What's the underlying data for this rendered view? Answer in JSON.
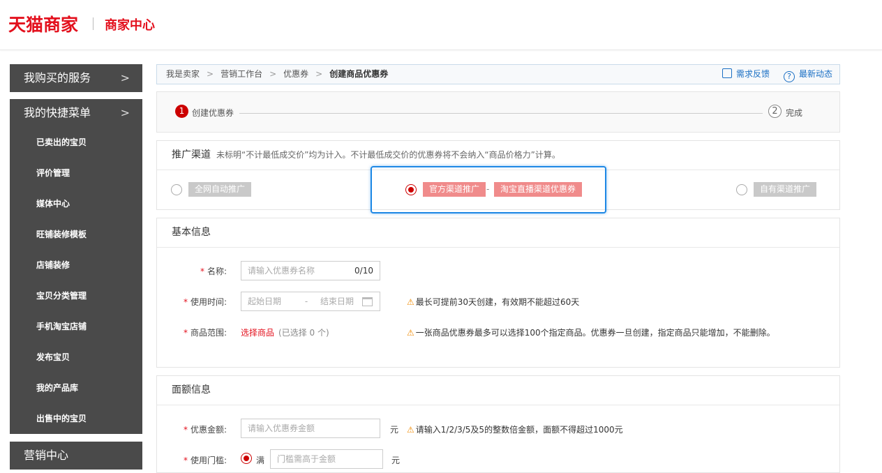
{
  "header": {
    "logo": "天猫商家",
    "sub": "商家中心"
  },
  "sidebar": {
    "section1": "我购买的服务",
    "section2": "我的快捷菜单",
    "items": [
      "已卖出的宝贝",
      "评价管理",
      "媒体中心",
      "旺铺装修模板",
      "店铺装修",
      "宝贝分类管理",
      "手机淘宝店铺",
      "发布宝贝",
      "我的产品库",
      "出售中的宝贝"
    ],
    "section3": "营销中心",
    "chevron": ">"
  },
  "breadcrumb": {
    "items": [
      "我是卖家",
      "营销工作台",
      "优惠券",
      "创建商品优惠券"
    ],
    "separator": ">",
    "feedback": "需求反馈",
    "news": "最新动态",
    "help_icon_glyph": "?"
  },
  "steps": {
    "step1_num": "1",
    "step1": "创建优惠券",
    "step2_num": "2",
    "step2": "完成"
  },
  "channel": {
    "title": "推广渠道",
    "note": "未标明“不计最低成交价”均为计入。不计最低成交价的优惠券将不会纳入“商品价格力”计算。",
    "option1": "全网自动推广",
    "option2a": "官方渠道推广",
    "option2_sep": "-",
    "option2b": "淘宝直播渠道优惠券",
    "option3": "自有渠道推广",
    "selected": "option2"
  },
  "basic": {
    "title": "基本信息",
    "name_label": "名称:",
    "name_placeholder": "请输入优惠券名称",
    "name_count": "0/10",
    "time_label": "使用时间:",
    "start_placeholder": "起始日期",
    "time_sep": "-",
    "end_placeholder": "结束日期",
    "time_warn": "最长可提前30天创建，有效期不能超过60天",
    "range_label": "商品范围:",
    "range_link": "选择商品",
    "range_count": "(已选择 0 个)",
    "range_warn": "一张商品优惠券最多可以选择100个指定商品。优惠券一旦创建，指定商品只能增加，不能删除。",
    "required_mark": "*",
    "warn_glyph": "⚠"
  },
  "amount": {
    "title": "面额信息",
    "value_label": "优惠金额:",
    "value_placeholder": "请输入优惠券金额",
    "unit": "元",
    "value_warn": "请输入1/2/3/5及5的整数倍金额，面额不得超过1000元",
    "threshold_label": "使用门槛:",
    "threshold_option": "满",
    "threshold_placeholder": "门槛需高于金额",
    "threshold_unit": "元"
  },
  "colors": {
    "brand": "#e3101d",
    "link": "#1a6fc4",
    "highlight": "#1e88e5",
    "sidebar": "#4a4a4a"
  }
}
